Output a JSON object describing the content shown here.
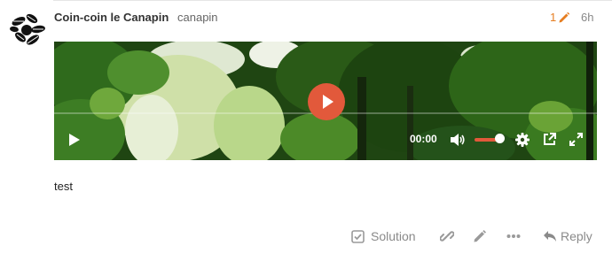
{
  "post": {
    "username": "Coin-coin le Canapin",
    "handle": "canapin",
    "edit_count": "1",
    "time": "6h",
    "body_text": "test"
  },
  "video": {
    "current_time": "00:00",
    "volume_level": 1.0,
    "progress": 0.0
  },
  "actions": {
    "solution_label": "Solution",
    "reply_label": "Reply"
  },
  "icons": {
    "avatar": "leaf-cluster-avatar-icon",
    "edit": "pencil-icon",
    "big_play": "play-icon",
    "play": "play-icon",
    "volume": "volume-icon",
    "settings": "gear-icon",
    "popout": "external-link-icon",
    "fullscreen": "fullscreen-icon",
    "solution": "checkbox-icon",
    "link": "link-icon",
    "edit_post": "pencil-icon",
    "more": "ellipsis-icon",
    "reply": "reply-icon"
  },
  "colors": {
    "accent": "#e67e22",
    "play_button": "#e2593b",
    "muted_text": "#8a8a8a"
  }
}
